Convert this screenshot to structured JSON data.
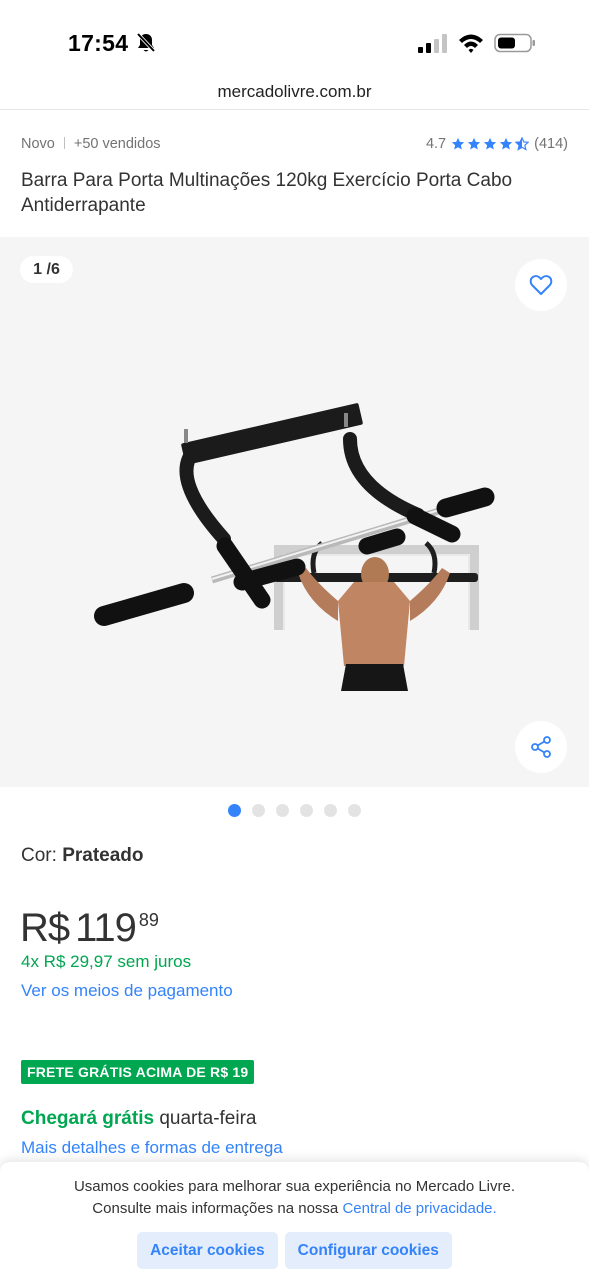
{
  "status_bar": {
    "time": "17:54",
    "icons": [
      "bell-slash-icon",
      "signal-icon",
      "wifi-icon",
      "battery-icon"
    ]
  },
  "browser": {
    "url": "mercadolivre.com.br"
  },
  "product": {
    "condition": "Novo",
    "sold": "+50 vendidos",
    "rating": "4.7",
    "rating_stars": 4.5,
    "reviews": "(414)",
    "title": "Barra Para Porta Multinações 120kg Exercício Porta Cabo Antiderrapante"
  },
  "gallery": {
    "counter": "1 /6",
    "total_images": 6,
    "active_index": 0
  },
  "variant": {
    "label": "Cor:",
    "value": "Prateado"
  },
  "price": {
    "currency": "R$",
    "integer": "119",
    "cents": "89",
    "installments": "4x R$ 29,97 sem juros",
    "payment_link": "Ver os meios de pagamento"
  },
  "shipping": {
    "badge": "FRETE GRÁTIS ACIMA DE R$ 19",
    "arrival_highlight": "Chegará grátis",
    "arrival_day": "quarta-feira",
    "details_link": "Mais detalhes e formas de entrega"
  },
  "cookies": {
    "line1": "Usamos cookies para melhorar sua experiência no Mercado Livre.",
    "line2": "Consulte mais informações na nossa",
    "link": "Central de privacidade.",
    "accept": "Aceitar cookies",
    "configure": "Configurar cookies"
  },
  "colors": {
    "accent": "#3483fa",
    "green": "#00a650",
    "gallery_bg": "#f5f5f5"
  }
}
